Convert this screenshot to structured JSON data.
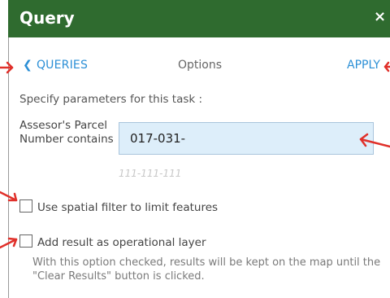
{
  "panel": {
    "title": "Query",
    "close_symbol": "×"
  },
  "nav": {
    "back_chevron": "❮",
    "back_label": "QUERIES",
    "tab_label": "Options",
    "apply_label": "APPLY"
  },
  "form": {
    "instructions": "Specify parameters for this task :",
    "parameter_label": "Assesor's Parcel Number contains",
    "parameter_value": "017-031-",
    "parameter_hint": "111-111-111",
    "spatial_filter_label": "Use spatial filter to limit features",
    "spatial_filter_checked": false,
    "operational_layer_label": "Add result as operational layer",
    "operational_layer_checked": false,
    "operational_layer_note": "With this option checked, results will be kept on the map until the \"Clear Results\" button is clicked."
  },
  "colors": {
    "titlebar": "#2f6b2f",
    "link": "#2b8fd6",
    "input_background": "#ddeefa",
    "annotation_arrow": "#e0302a"
  },
  "icons": {
    "close": "close-icon",
    "back": "chevron-left-icon",
    "annotation": "red-arrow-icon"
  }
}
